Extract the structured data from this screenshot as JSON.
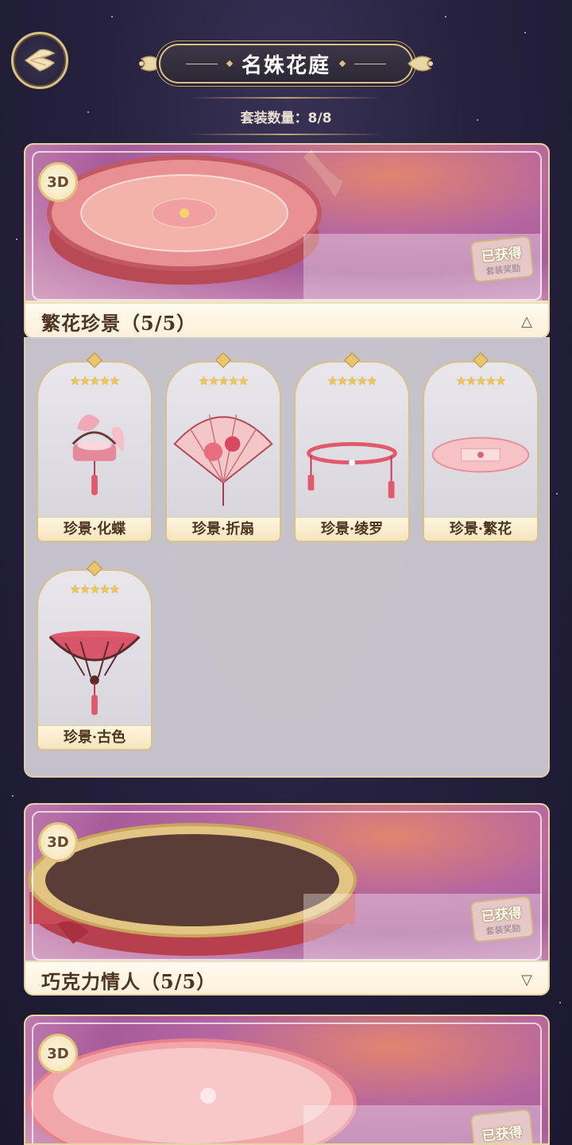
{
  "header": {
    "title": "名姝花庭",
    "subtitle": "套装数量：8/8",
    "back_icon": "back-wing-icon"
  },
  "sets": [
    {
      "title": "繁花珍景（5/5）",
      "badge": "3D",
      "stamp_main": "已获得",
      "stamp_sub": "套装奖励",
      "toggle": "△",
      "expanded": true,
      "items": [
        {
          "stars": "★★★★★",
          "name": "珍景·化蝶"
        },
        {
          "stars": "★★★★★",
          "name": "珍景·折扇"
        },
        {
          "stars": "★★★★★",
          "name": "珍景·绫罗"
        },
        {
          "stars": "★★★★★",
          "name": "珍景·繁花"
        },
        {
          "stars": "★★★★★",
          "name": "珍景·古色"
        }
      ]
    },
    {
      "title": "巧克力情人（5/5）",
      "badge": "3D",
      "stamp_main": "已获得",
      "stamp_sub": "套装奖励",
      "toggle": "▽",
      "expanded": false
    },
    {
      "title": "",
      "badge": "3D",
      "stamp_main": "已获得",
      "expanded": false
    }
  ],
  "colors": {
    "gold": "#d8c08a",
    "star": "#f1c84a",
    "title_text": "#4d3420"
  }
}
